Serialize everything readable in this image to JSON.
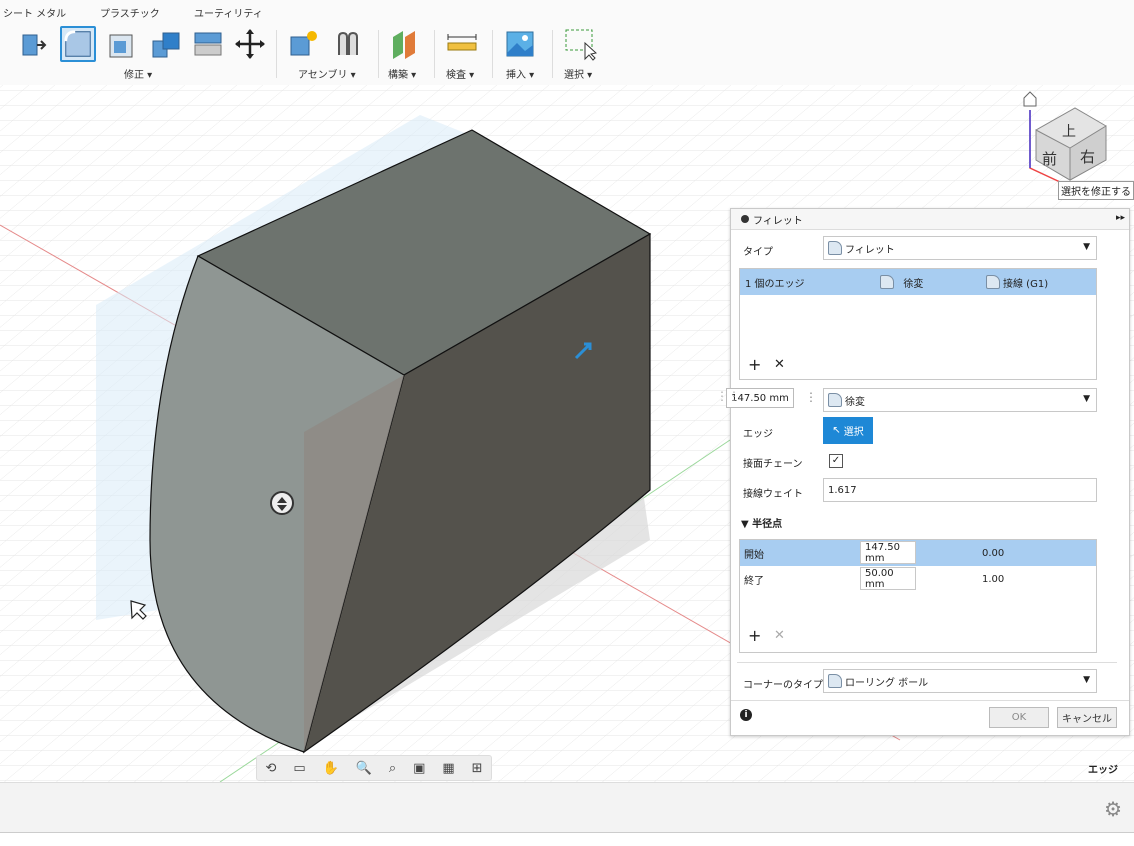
{
  "toolbar": {
    "tabs": [
      "シート メタル",
      "プラスチック",
      "ユーティリティ"
    ],
    "groups": {
      "modify": "修正 ▾",
      "assembly": "アセンブリ ▾",
      "construct": "構築 ▾",
      "inspect": "検査 ▾",
      "insert": "挿入 ▾",
      "select": "選択 ▾"
    }
  },
  "viewcube": {
    "top": "上",
    "front": "前",
    "right": "右",
    "tooltip": "選択を修正する"
  },
  "dialog": {
    "title": "フィレット",
    "type_label": "タイプ",
    "type_value": "フィレット",
    "edge_list": {
      "count": "1 個のエッジ",
      "radius_type": "徐変",
      "continuity": "接線 (G1)"
    },
    "radius_chip": "147.50 mm",
    "radius_type_value": "徐変",
    "edge_label": "エッジ",
    "select_button": "選択",
    "tangent_chain_label": "接面チェーン",
    "tangent_chain_checked": "✓",
    "tangent_weight_label": "接線ウェイト",
    "tangent_weight_value": "1.617",
    "radius_points_section": "▼ 半径点",
    "radius_points": [
      {
        "name": "開始",
        "value": "147.50 mm",
        "pos": "0.00"
      },
      {
        "name": "終了",
        "value": "50.00 mm",
        "pos": "1.00"
      }
    ],
    "corner_type_label": "コーナーのタイプ",
    "corner_type_value": "ローリング ボール",
    "ok": "OK",
    "cancel": "キャンセル"
  },
  "status": {
    "selection_type": "エッジ"
  }
}
